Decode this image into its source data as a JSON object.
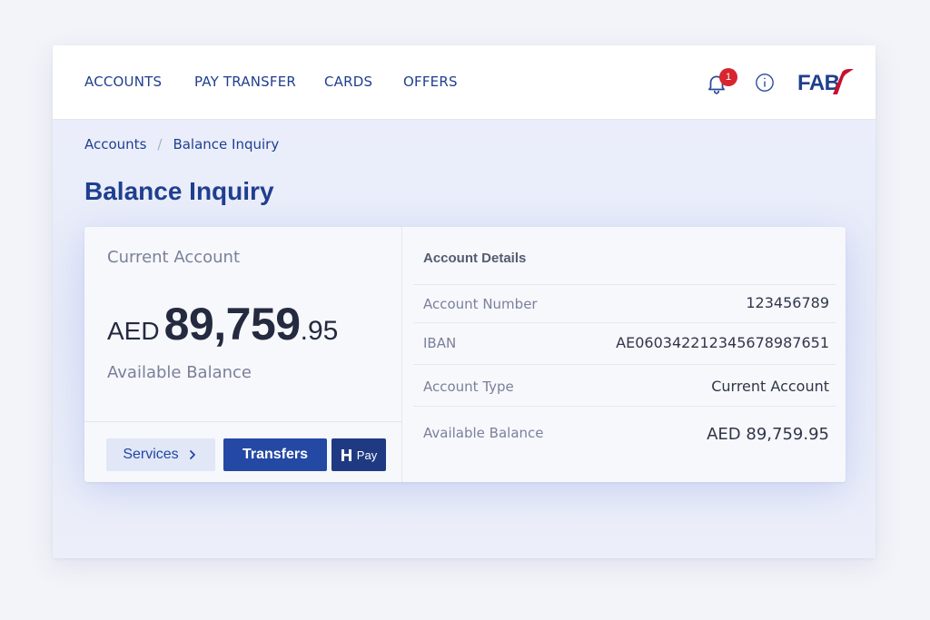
{
  "nav": {
    "items": [
      "ACCOUNTS",
      "PAY TRANSFER",
      "CARDS",
      "OFFERS"
    ],
    "notification_count": "1",
    "logo": "FAB"
  },
  "breadcrumb": {
    "root": "Accounts",
    "separator": "/",
    "current": "Balance Inquiry"
  },
  "page_title": "Balance Inquiry",
  "account": {
    "type": "Current Account",
    "currency": "AED",
    "balance_whole": "89,759",
    "balance_decimal": ".95",
    "available_label": "Available Balance"
  },
  "actions": {
    "services": "Services",
    "transfers": "Transfers",
    "pay": "Pay"
  },
  "details": {
    "title": "Account Details",
    "rows": [
      {
        "label": "Account Number",
        "value": "123456789"
      },
      {
        "label": "IBAN",
        "value": "AE060342212345678987651"
      },
      {
        "label": "Account Type",
        "value": "Current Account"
      },
      {
        "label": "Available Balance",
        "value": "AED 89,759.95"
      }
    ]
  },
  "colors": {
    "brand": "#1f3f8f",
    "accent": "#2449a4",
    "badge": "#d7262f",
    "logo_mark": "#c8102e"
  },
  "icons": [
    "bell-icon",
    "info-icon",
    "chevron-right-icon",
    "pay-icon",
    "fab-logo-mark"
  ]
}
